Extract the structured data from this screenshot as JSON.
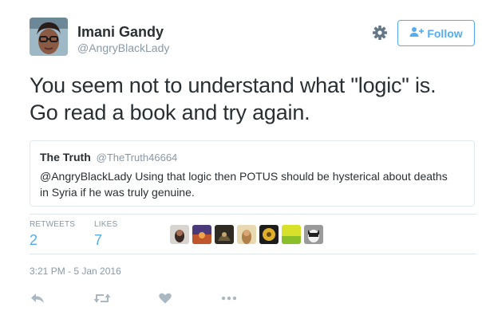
{
  "user": {
    "name": "Imani Gandy",
    "handle": "@AngryBlackLady"
  },
  "header": {
    "follow_label": "Follow"
  },
  "tweet": {
    "line1": "You seem not to understand what \"logic\" is.",
    "line2": "Go read a book and try again."
  },
  "quoted": {
    "name": "The Truth",
    "handle": "@TheTruth46664",
    "text": "@AngryBlackLady Using that logic then POTUS should be hysterical about deaths in Syria if he was truly genuine."
  },
  "stats": {
    "retweets_label": "RETWEETS",
    "retweets_value": "2",
    "likes_label": "LIKES",
    "likes_value": "7"
  },
  "timestamp": "3:21 PM - 5 Jan 2016",
  "colors": {
    "accent": "#55acee",
    "text": "#292f33",
    "muted": "#8899a6",
    "border": "#e1e8ed"
  },
  "icons": {
    "settings": "gear-icon",
    "follow": "person-plus-icon",
    "reply": "reply-icon",
    "retweet": "retweet-icon",
    "like": "heart-icon",
    "more": "more-dots-icon"
  }
}
